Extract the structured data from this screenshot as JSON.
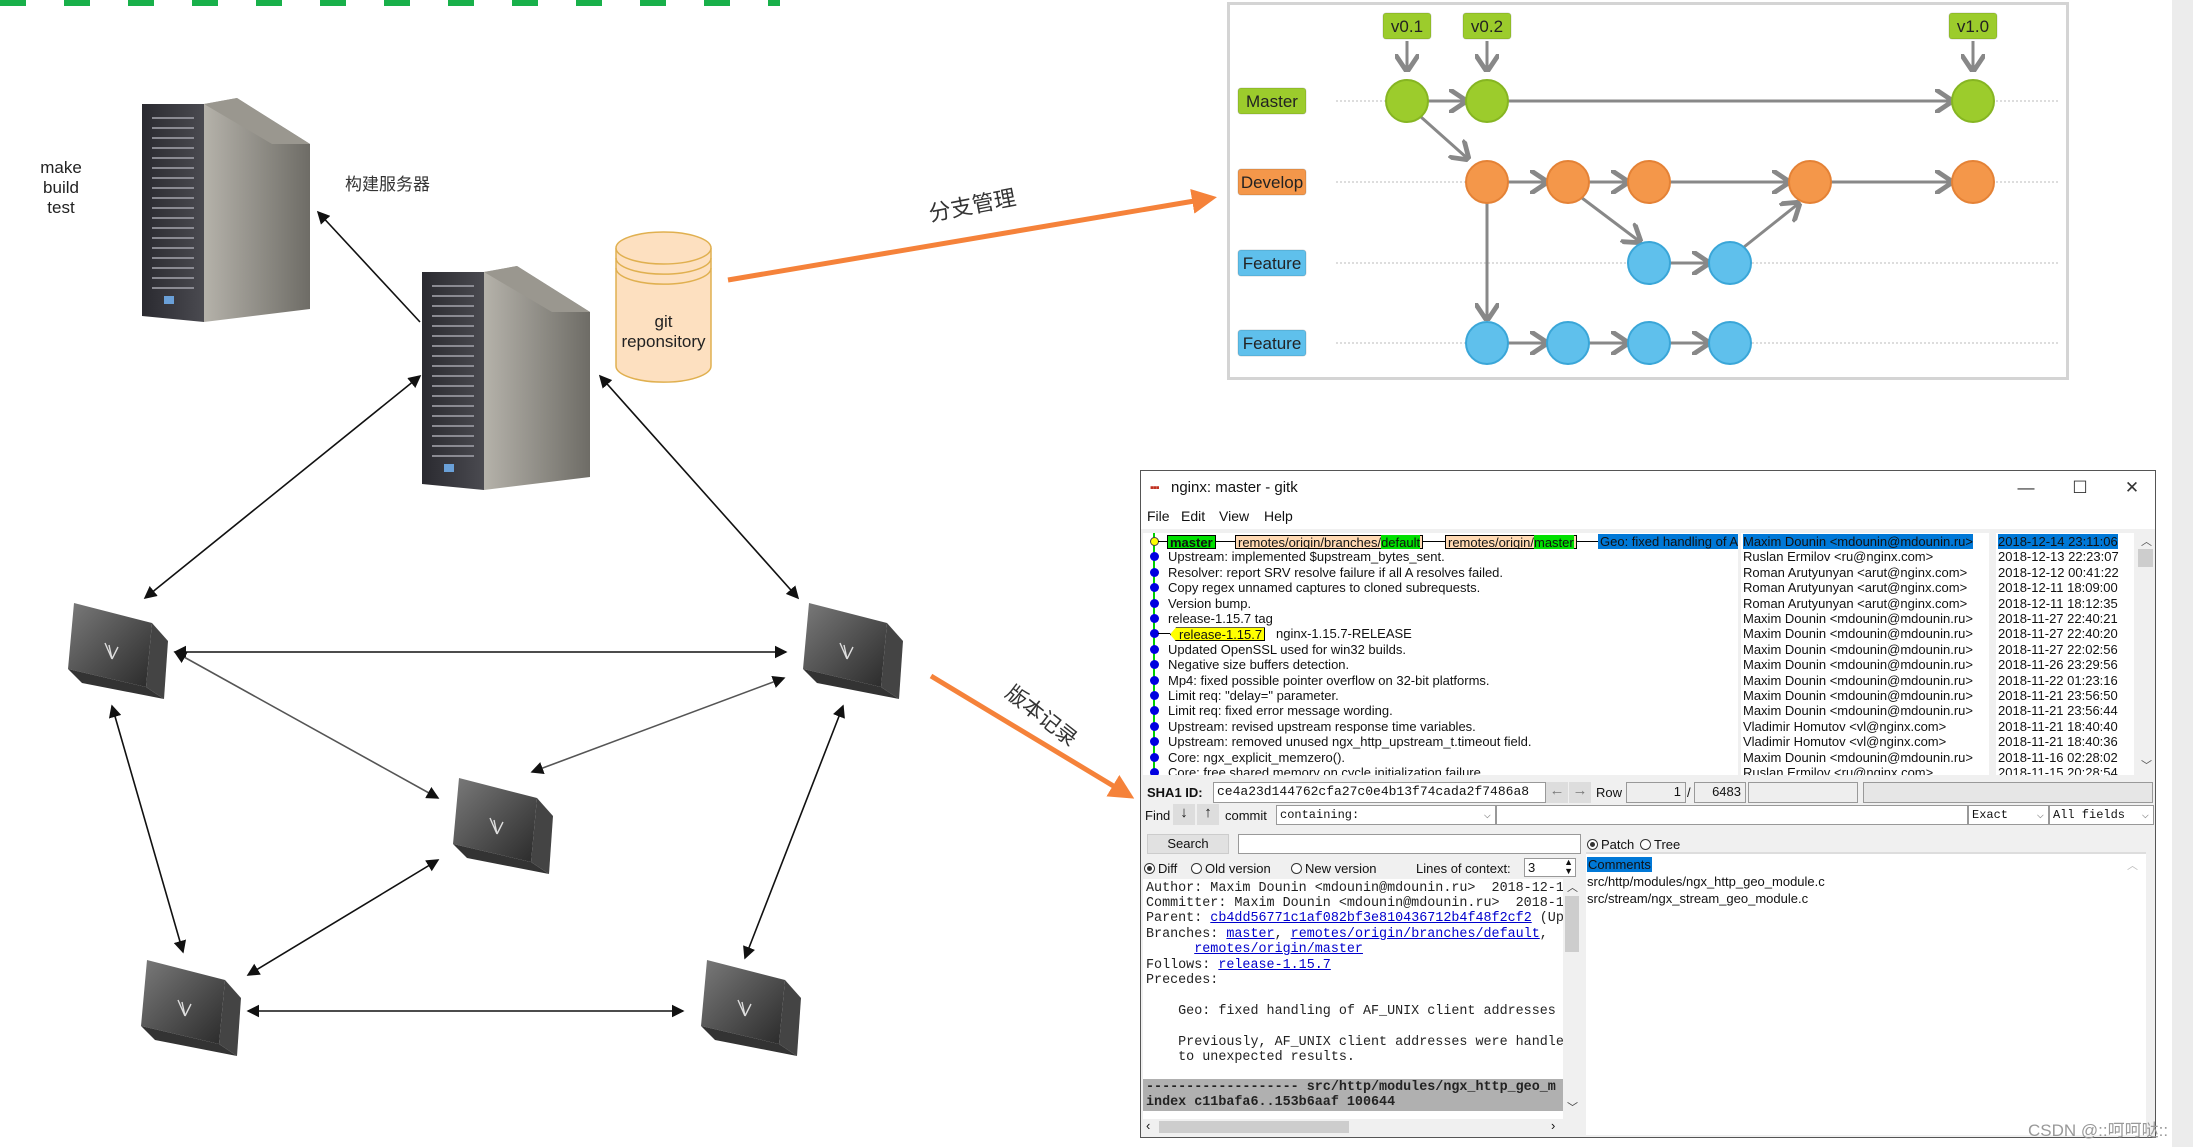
{
  "diagram": {
    "build_notes": [
      "make",
      "build",
      "test"
    ],
    "build_server_label": "构建服务器",
    "repo_label": [
      "git",
      "reponsitory"
    ],
    "branch_arrow_label": "分支管理",
    "history_arrow_label": "版本记录",
    "arrow_color": "#f5823a"
  },
  "branch_model": {
    "tags": [
      "v0.1",
      "v0.2",
      "v1.0"
    ],
    "lanes": [
      {
        "label": "Master",
        "color": "#9ccc2c"
      },
      {
        "label": "Develop",
        "color": "#f4974a"
      },
      {
        "label": "Feature",
        "color": "#5fc0ec"
      },
      {
        "label": "Feature",
        "color": "#5fc0ec"
      }
    ]
  },
  "gitk": {
    "title": "nginx: master - gitk",
    "menu": [
      "File",
      "Edit",
      "View",
      "Help"
    ],
    "refs": {
      "head": "master",
      "remote1_a": "remotes/origin/branches/",
      "remote1_b": "default",
      "remote2_a": "remotes/origin/",
      "remote2_b": "master",
      "head_msg": "Geo: fixed handling of A",
      "release_tag": "release-1.15.7"
    },
    "commits": [
      {
        "msg": "",
        "author": "Maxim Dounin <mdounin@mdounin.ru>",
        "date": "2018-12-14 23:11:06"
      },
      {
        "msg": "Upstream: implemented $upstream_bytes_sent.",
        "author": "Ruslan Ermilov <ru@nginx.com>",
        "date": "2018-12-13 22:23:07"
      },
      {
        "msg": "Resolver: report SRV resolve failure if all A resolves failed.",
        "author": "Roman Arutyunyan <arut@nginx.com>",
        "date": "2018-12-12 00:41:22"
      },
      {
        "msg": "Copy regex unnamed captures to cloned subrequests.",
        "author": "Roman Arutyunyan <arut@nginx.com>",
        "date": "2018-12-11 18:09:00"
      },
      {
        "msg": "Version bump.",
        "author": "Roman Arutyunyan <arut@nginx.com>",
        "date": "2018-12-11 18:12:35"
      },
      {
        "msg": "release-1.15.7 tag",
        "author": "Maxim Dounin <mdounin@mdounin.ru>",
        "date": "2018-11-27 22:40:21"
      },
      {
        "msg": "nginx-1.15.7-RELEASE",
        "author": "Maxim Dounin <mdounin@mdounin.ru>",
        "date": "2018-11-27 22:40:20"
      },
      {
        "msg": "Updated OpenSSL used for win32 builds.",
        "author": "Maxim Dounin <mdounin@mdounin.ru>",
        "date": "2018-11-27 22:02:56"
      },
      {
        "msg": "Negative size buffers detection.",
        "author": "Maxim Dounin <mdounin@mdounin.ru>",
        "date": "2018-11-26 23:29:56"
      },
      {
        "msg": "Mp4: fixed possible pointer overflow on 32-bit platforms.",
        "author": "Maxim Dounin <mdounin@mdounin.ru>",
        "date": "2018-11-22 01:23:16"
      },
      {
        "msg": "Limit req: \"delay=\" parameter.",
        "author": "Maxim Dounin <mdounin@mdounin.ru>",
        "date": "2018-11-21 23:56:50"
      },
      {
        "msg": "Limit req: fixed error message wording.",
        "author": "Maxim Dounin <mdounin@mdounin.ru>",
        "date": "2018-11-21 23:56:44"
      },
      {
        "msg": "Upstream: revised upstream response time variables.",
        "author": "Vladimir Homutov <vl@nginx.com>",
        "date": "2018-11-21 18:40:40"
      },
      {
        "msg": "Upstream: removed unused ngx_http_upstream_t.timeout field.",
        "author": "Vladimir Homutov <vl@nginx.com>",
        "date": "2018-11-21 18:40:36"
      },
      {
        "msg": "Core: ngx_explicit_memzero().",
        "author": "Maxim Dounin <mdounin@mdounin.ru>",
        "date": "2018-11-16 02:28:02"
      },
      {
        "msg": "Core: free shared memory on cycle initialization failure.",
        "author": "Ruslan Ermilov <ru@nginx.com>",
        "date": "2018-11-15 20:28:54"
      }
    ],
    "sha_label": "SHA1 ID:",
    "sha_value": "ce4a23d144762cfa27c0e4b13f74cada2f7486a8",
    "row_label": "Row",
    "row_current": "1",
    "row_sep": "/",
    "row_total": "6483",
    "find_label": "Find",
    "find_type": "commit",
    "find_mode": "containing:",
    "find_match": "Exact",
    "find_fields": "All fields",
    "search_button": "Search",
    "diff_options": [
      "Diff",
      "Old version",
      "New version"
    ],
    "context_label": "Lines of context:",
    "context_value": "3",
    "view_options": [
      "Patch",
      "Tree"
    ],
    "files": [
      "Comments",
      "src/http/modules/ngx_http_geo_module.c",
      "src/stream/ngx_stream_geo_module.c"
    ],
    "details": {
      "author": "Author: Maxim Dounin <mdounin@mdounin.ru>  2018-12-1",
      "committer": "Committer: Maxim Dounin <mdounin@mdounin.ru>  2018-1",
      "parent_label": "Parent: ",
      "parent_link": "cb4dd56771c1af082bf3e810436712b4f48f2cf2",
      "parent_rest": " (Up",
      "branches_label": "Branches: ",
      "branch_links": [
        "master",
        "remotes/origin/branches/default",
        "remotes/origin/master"
      ],
      "follows_label": "Follows: ",
      "follows_link": "release-1.15.7",
      "precedes": "Precedes:",
      "body1": "    Geo: fixed handling of AF_UNIX client addresses",
      "body2": "    Previously, AF_UNIX client addresses were handle",
      "body3": "    to unexpected results.",
      "file_header": "------------------- src/http/modules/ngx_http_geo_m",
      "index_line": "index c11bafa6..153b6aaf 100644"
    }
  },
  "watermark": "CSDN @::呵呵哒::"
}
